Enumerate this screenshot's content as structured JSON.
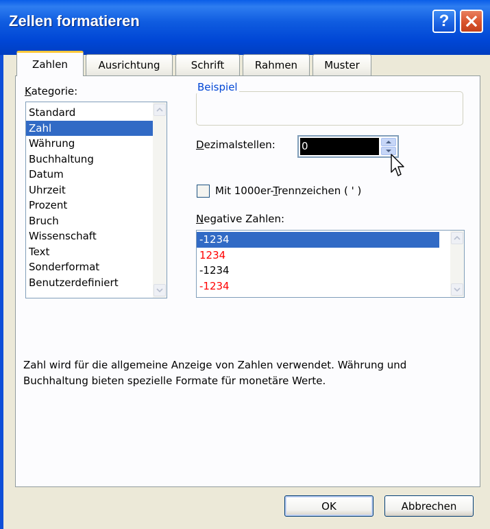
{
  "window": {
    "title": "Zellen formatieren",
    "help_glyph": "?",
    "close_icon": "close-icon"
  },
  "tabs": [
    {
      "label": "Zahlen",
      "active": true
    },
    {
      "label": "Ausrichtung",
      "active": false
    },
    {
      "label": "Schrift",
      "active": false
    },
    {
      "label": "Rahmen",
      "active": false
    },
    {
      "label": "Muster",
      "active": false
    }
  ],
  "category": {
    "label_u": "K",
    "label_rest": "ategorie:",
    "items": [
      "Standard",
      "Zahl",
      "Währung",
      "Buchhaltung",
      "Datum",
      "Uhrzeit",
      "Prozent",
      "Bruch",
      "Wissenschaft",
      "Text",
      "Sonderformat",
      "Benutzerdefiniert"
    ],
    "selected": "Zahl"
  },
  "sample": {
    "group_label": "Beispiel",
    "value": ""
  },
  "decimals": {
    "label_u": "D",
    "label_rest": "ezimalstellen:",
    "value": "0"
  },
  "thousands": {
    "label_pre": "Mit 1000er-",
    "label_u": "T",
    "label_post": "rennzeichen ( ' )",
    "checked": false
  },
  "negative": {
    "label_u": "N",
    "label_rest": "egative Zahlen:",
    "items": [
      {
        "text": "-1234",
        "color": "#000000"
      },
      {
        "text": "1234",
        "color": "#ff0000"
      },
      {
        "text": "-1234",
        "color": "#000000"
      },
      {
        "text": "-1234",
        "color": "#ff0000"
      }
    ],
    "selected_index": 0
  },
  "description": "Zahl wird für die allgemeine Anzeige von Zahlen verwendet. Währung und Buchhaltung bieten spezielle Formate für monetäre Werte.",
  "buttons": {
    "ok": "OK",
    "cancel": "Abbrechen"
  },
  "colors": {
    "titlebar": "#0046d5",
    "selection": "#316ac5",
    "group_title": "#0046d5",
    "negative_red": "#ff0000"
  }
}
